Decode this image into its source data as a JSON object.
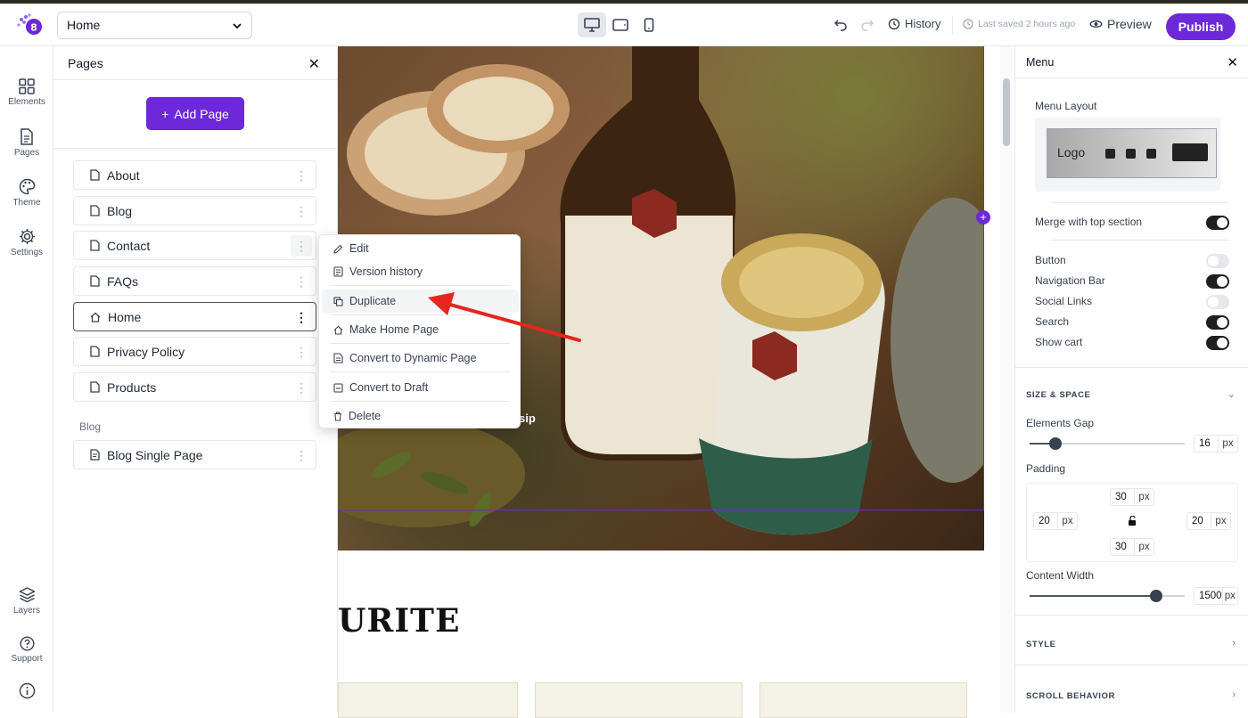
{
  "topbar": {
    "page_selected": "Home",
    "history_label": "History",
    "saved_text": "Last saved 2 hours ago",
    "preview_label": "Preview",
    "publish_label": "Publish",
    "accent": "#6d28d9"
  },
  "rail": {
    "elements": "Elements",
    "pages": "Pages",
    "theme": "Theme",
    "settings": "Settings",
    "layers": "Layers",
    "support": "Support"
  },
  "pages_panel": {
    "title": "Pages",
    "add_page": "Add Page",
    "pages": [
      {
        "label": "About",
        "icon": "page-icon"
      },
      {
        "label": "Blog",
        "icon": "page-icon"
      },
      {
        "label": "Contact",
        "icon": "page-icon"
      },
      {
        "label": "FAQs",
        "icon": "page-icon"
      },
      {
        "label": "Home",
        "icon": "home-icon"
      },
      {
        "label": "Privacy Policy",
        "icon": "page-icon"
      },
      {
        "label": "Products",
        "icon": "page-icon"
      }
    ],
    "blog_section": "Blog",
    "blog_pages": [
      {
        "label": "Blog Single Page",
        "icon": "blog-page-icon"
      }
    ]
  },
  "context_menu": {
    "items": [
      {
        "label": "Edit",
        "icon": "pencil-icon"
      },
      {
        "label": "Version history",
        "icon": "history-doc-icon"
      },
      {
        "label": "Duplicate",
        "icon": "duplicate-icon"
      },
      {
        "label": "Make Home Page",
        "icon": "home-icon"
      },
      {
        "label": "Convert to Dynamic Page",
        "icon": "dynamic-page-icon"
      },
      {
        "label": "Convert to Draft",
        "icon": "draft-icon"
      },
      {
        "label": "Delete",
        "icon": "trash-icon"
      }
    ]
  },
  "canvas": {
    "hero_caption_fragment": "sip",
    "heading_fragment": "URITE"
  },
  "right_panel": {
    "title": "Menu",
    "menu_layout_label": "Menu Layout",
    "layout_logo": "Logo",
    "merge_label": "Merge with top section",
    "merge_on": true,
    "toggles": [
      {
        "label": "Button",
        "on": false
      },
      {
        "label": "Navigation Bar",
        "on": true
      },
      {
        "label": "Social Links",
        "on": false
      },
      {
        "label": "Search",
        "on": true
      },
      {
        "label": "Show cart",
        "on": true
      }
    ],
    "size_space": "SIZE & SPACE",
    "elements_gap_label": "Elements Gap",
    "elements_gap_value": "16",
    "unit": "px",
    "padding_label": "Padding",
    "padding": {
      "top": "30",
      "left": "20",
      "right": "20",
      "bottom": "30"
    },
    "content_width_label": "Content Width",
    "content_width_value": "1500",
    "style_label": "STYLE",
    "scroll_label": "SCROLL BEHAVIOR"
  }
}
